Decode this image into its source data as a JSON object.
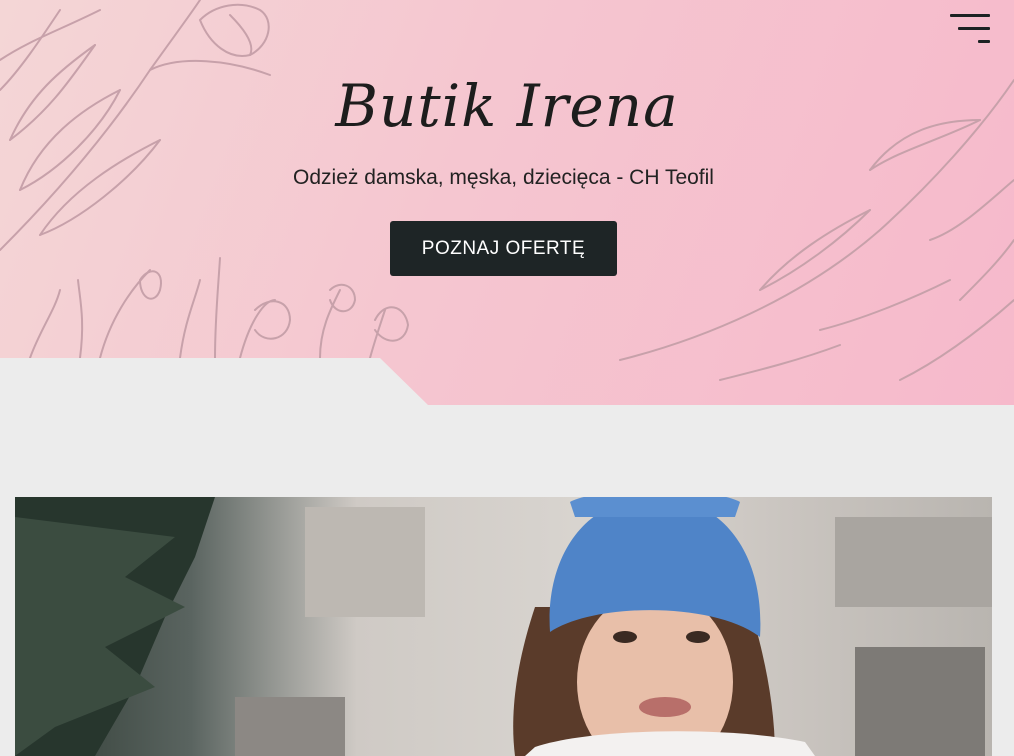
{
  "header": {
    "brand_title": "Butik Irena",
    "tagline": "Odzież damska, męska, dziecięca - CH Teofil",
    "cta_label": "POZNAJ OFERTĘ",
    "menu_icon": "hamburger-menu-icon"
  },
  "hero_photo": {
    "alt": "Kobieta w niebieskiej czapce"
  },
  "colors": {
    "hero_gradient_start": "#f4d6d6",
    "hero_gradient_end": "#f6b9cb",
    "button_bg": "#1e2526",
    "page_bg": "#ececec"
  }
}
